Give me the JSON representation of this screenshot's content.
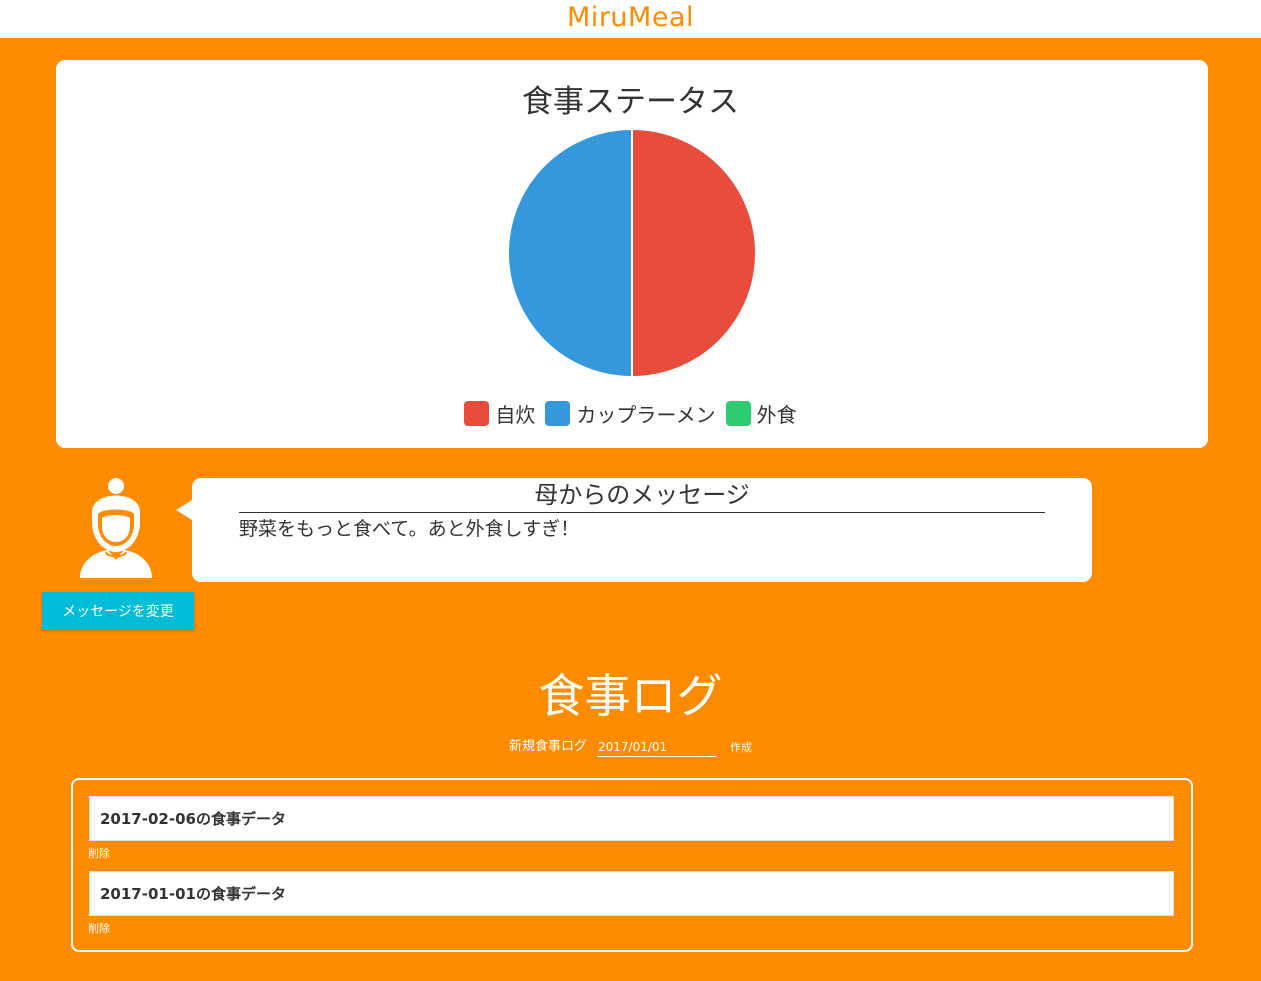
{
  "header": {
    "brand": "MiruMeal"
  },
  "status": {
    "chart_title": "食事ステータス"
  },
  "chart_data": {
    "type": "pie",
    "title": "食事ステータス",
    "categories": [
      "自炊",
      "カップラーメン",
      "外食"
    ],
    "values": [
      1,
      1,
      0
    ],
    "colors": [
      "#e74c3c",
      "#3498db",
      "#2ecc71"
    ],
    "legend": "bottom"
  },
  "message": {
    "title": "母からのメッセージ",
    "body": "野菜をもっと食べて。あと外食しすぎ！",
    "change_button": "メッセージを変更",
    "avatar_icon": "mother-avatar-icon"
  },
  "log": {
    "heading": "食事ログ",
    "new_label": "新規食事ログ",
    "date_value": "2017/01/01",
    "create_button": "作成",
    "items": [
      {
        "title": "2017-02-06の食事データ",
        "delete_label": "削除"
      },
      {
        "title": "2017-01-01の食事データ",
        "delete_label": "削除"
      }
    ]
  }
}
